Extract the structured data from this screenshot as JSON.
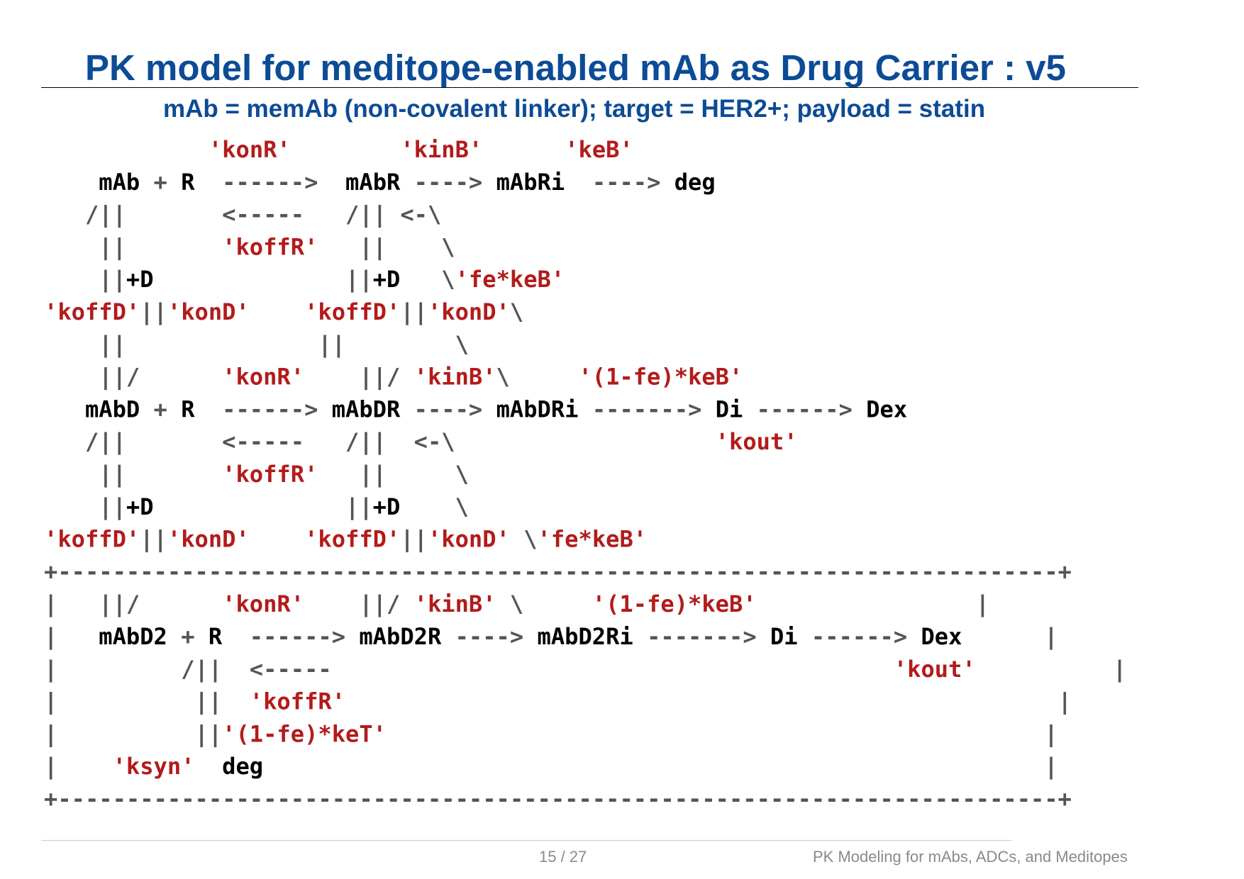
{
  "slide": {
    "title": "PK model for meditope-enabled mAb as Drug Carrier : v5",
    "subtitle": "mAb = memAb (non-covalent linker); target = HER2+; payload = statin",
    "page_number": "15 / 27",
    "footer_title": "PK Modeling for mAbs, ADCs, and Meditopes"
  },
  "colors": {
    "title": "#0c4b96",
    "species": "#000000",
    "operator": "#555555",
    "rate": "#b31b1b"
  },
  "diagram": {
    "lines": [
      [
        [
          "r",
          "            'konR'        'kinB'      'keB'"
        ]
      ],
      [
        [
          "s",
          "    mAb"
        ],
        [
          "o",
          " + "
        ],
        [
          "s",
          "R"
        ],
        [
          "o",
          "  ------>  "
        ],
        [
          "s",
          "mAbR"
        ],
        [
          "o",
          " ----> "
        ],
        [
          "s",
          "mAbRi"
        ],
        [
          "o",
          "  ----> "
        ],
        [
          "s",
          "deg"
        ]
      ],
      [
        [
          "o",
          "   /||       <-----   /|| <-\\"
        ]
      ],
      [
        [
          "o",
          "    ||       "
        ],
        [
          "r",
          "'koffR'"
        ],
        [
          "o",
          "   ||    \\"
        ]
      ],
      [
        [
          "o",
          "    ||"
        ],
        [
          "s",
          "+D"
        ],
        [
          "o",
          "              ||"
        ],
        [
          "s",
          "+D"
        ],
        [
          "o",
          "   \\"
        ],
        [
          "r",
          "'fe*keB'"
        ]
      ],
      [
        [
          "r",
          "'koffD'"
        ],
        [
          "o",
          "||"
        ],
        [
          "r",
          "'konD'"
        ],
        [
          "o",
          "    "
        ],
        [
          "r",
          "'koffD'"
        ],
        [
          "o",
          "||"
        ],
        [
          "r",
          "'konD'"
        ],
        [
          "o",
          "\\"
        ]
      ],
      [
        [
          "o",
          "    ||              ||        \\"
        ]
      ],
      [
        [
          "o",
          "    ||/      "
        ],
        [
          "r",
          "'konR'"
        ],
        [
          "o",
          "    ||/ "
        ],
        [
          "r",
          "'kinB'"
        ],
        [
          "o",
          "\\     "
        ],
        [
          "r",
          "'(1-fe)*keB'"
        ]
      ],
      [
        [
          "s",
          "   mAbD"
        ],
        [
          "o",
          " + "
        ],
        [
          "s",
          "R"
        ],
        [
          "o",
          "  ------> "
        ],
        [
          "s",
          "mAbDR"
        ],
        [
          "o",
          " ----> "
        ],
        [
          "s",
          "mAbDRi"
        ],
        [
          "o",
          " -------> "
        ],
        [
          "s",
          "Di"
        ],
        [
          "o",
          " ------> "
        ],
        [
          "s",
          "Dex"
        ]
      ],
      [
        [
          "o",
          "   /||       <-----   /||  <-\\"
        ],
        [
          "r",
          "                   'kout'"
        ]
      ],
      [
        [
          "o",
          "    ||       "
        ],
        [
          "r",
          "'koffR'"
        ],
        [
          "o",
          "   ||     \\"
        ]
      ],
      [
        [
          "o",
          "    ||"
        ],
        [
          "s",
          "+D"
        ],
        [
          "o",
          "              ||"
        ],
        [
          "s",
          "+D"
        ],
        [
          "o",
          "    \\"
        ]
      ],
      [
        [
          "r",
          "'koffD'"
        ],
        [
          "o",
          "||"
        ],
        [
          "r",
          "'konD'"
        ],
        [
          "o",
          "    "
        ],
        [
          "r",
          "'koffD'"
        ],
        [
          "o",
          "||"
        ],
        [
          "r",
          "'konD'"
        ],
        [
          "o",
          " \\"
        ],
        [
          "r",
          "'fe*keB'"
        ]
      ],
      [
        [
          "o",
          "+-------------------------------------------------------------------------+"
        ]
      ],
      [
        [
          "o",
          "|   ||/      "
        ],
        [
          "r",
          "'konR'"
        ],
        [
          "o",
          "    ||/ "
        ],
        [
          "r",
          "'kinB'"
        ],
        [
          "o",
          " \\     "
        ],
        [
          "r",
          "'(1-fe)*keB'"
        ],
        [
          "o",
          "                |"
        ]
      ],
      [
        [
          "o",
          "|   "
        ],
        [
          "s",
          "mAbD2"
        ],
        [
          "o",
          " + "
        ],
        [
          "s",
          "R"
        ],
        [
          "o",
          "  ------> "
        ],
        [
          "s",
          "mAbD2R"
        ],
        [
          "o",
          " ----> "
        ],
        [
          "s",
          "mAbD2Ri"
        ],
        [
          "o",
          " -------> "
        ],
        [
          "s",
          "Di"
        ],
        [
          "o",
          " ------> "
        ],
        [
          "s",
          "Dex"
        ],
        [
          "o",
          "      |"
        ]
      ],
      [
        [
          "o",
          "|         /||  <-----"
        ],
        [
          "r",
          "                                         'kout'"
        ],
        [
          "o",
          "          |"
        ]
      ],
      [
        [
          "o",
          "|          ||  "
        ],
        [
          "r",
          "'koffR'"
        ],
        [
          "o",
          "                                                    |"
        ]
      ],
      [
        [
          "o",
          "|          ||"
        ],
        [
          "r",
          "'(1-fe)*keT'"
        ],
        [
          "o",
          "                                                |"
        ]
      ],
      [
        [
          "o",
          "|    "
        ],
        [
          "r",
          "'ksyn'"
        ],
        [
          "o",
          "  "
        ],
        [
          "s",
          "deg"
        ],
        [
          "o",
          "                                                         |"
        ]
      ],
      [
        [
          "o",
          "+-------------------------------------------------------------------------+"
        ]
      ]
    ]
  }
}
